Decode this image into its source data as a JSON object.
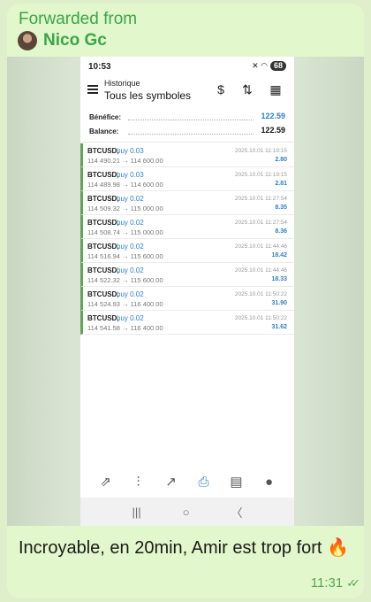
{
  "message": {
    "forwarded_label": "Forwarded from",
    "sender_name": "Nico Gc",
    "caption": "Incroyable,  en 20min, Amir est trop fort 🔥",
    "time": "11:31",
    "read_ticks": "✓✓"
  },
  "screenshot": {
    "status": {
      "time": "10:53",
      "icons": "◂ ◎",
      "right_icons": "✕ ◠ ",
      "battery": "68"
    },
    "header": {
      "subtitle": "Historique",
      "title": "Tous les symboles"
    },
    "summary": [
      {
        "label": "Bénéfice:",
        "value": "122.59",
        "color": "#2f7fc8"
      },
      {
        "label": "Balance:",
        "value": "122.59",
        "color": "#111111"
      }
    ],
    "trades": [
      {
        "symbol": "BTCUSD,",
        "side": "buy 0.03",
        "prices": "114 490.21 → 114 600.00",
        "date": "2025.10.01 11:19:15",
        "profit": "2.80"
      },
      {
        "symbol": "BTCUSD,",
        "side": "buy 0.03",
        "prices": "114 489.98 → 114 600.00",
        "date": "2025.10.01 11:19:15",
        "profit": "2.81"
      },
      {
        "symbol": "BTCUSD,",
        "side": "buy 0.02",
        "prices": "114 509.32 → 115 000.00",
        "date": "2025.10.01 11:27:54",
        "profit": "8.35"
      },
      {
        "symbol": "BTCUSD,",
        "side": "buy 0.02",
        "prices": "114 508.74 → 115 000.00",
        "date": "2025.10.01 11:27:54",
        "profit": "8.36"
      },
      {
        "symbol": "BTCUSD,",
        "side": "buy 0.02",
        "prices": "114 516.94 → 115 600.00",
        "date": "2025.10.01 11:44:46",
        "profit": "18.42"
      },
      {
        "symbol": "BTCUSD,",
        "side": "buy 0.02",
        "prices": "114 522.32 → 115 600.00",
        "date": "2025.10.01 11:44:46",
        "profit": "18.33"
      },
      {
        "symbol": "BTCUSD,",
        "side": "buy 0.02",
        "prices": "114 524.93 → 116 400.00",
        "date": "2025.10.01 11:50:22",
        "profit": "31.90"
      },
      {
        "symbol": "BTCUSD,",
        "side": "buy 0.02",
        "prices": "114 541.58 → 116 400.00",
        "date": "2025.10.01 11:50:22",
        "profit": "31.62"
      }
    ],
    "bottom_nav": [
      {
        "name": "quotes-icon",
        "glyph": "⇗"
      },
      {
        "name": "chart-icon",
        "glyph": "⫶"
      },
      {
        "name": "trade-icon",
        "glyph": "↗"
      },
      {
        "name": "history-icon",
        "glyph": "⎙"
      },
      {
        "name": "news-icon",
        "glyph": "▤"
      },
      {
        "name": "messages-icon",
        "glyph": "●"
      }
    ],
    "system_nav": {
      "recent": "|||",
      "home": "○",
      "back": "〈"
    }
  },
  "colors": {
    "accent_green": "#3aa64a",
    "bubble": "#e2f7cb",
    "profit_blue": "#2f7fc8"
  }
}
